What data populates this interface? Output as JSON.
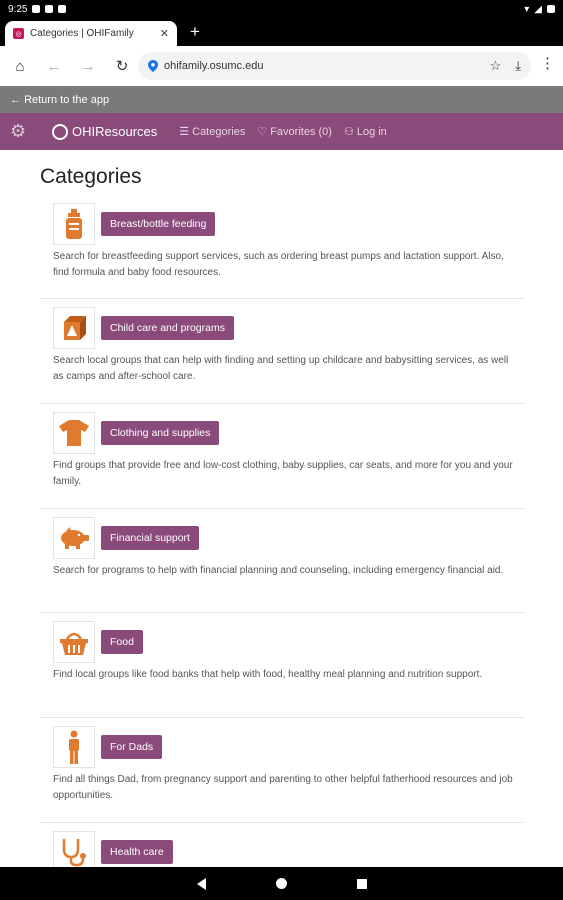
{
  "status": {
    "time": "9:25"
  },
  "browser": {
    "tab_title": "Categories | OHIFamily",
    "tab_close": "✕",
    "new_tab": "+",
    "url": "ohifamily.osumc.edu"
  },
  "returnbar": {
    "label": "Return to the app"
  },
  "nav": {
    "brand": "OHIResources",
    "links": [
      {
        "label": "Categories",
        "icon": "list-icon"
      },
      {
        "label": "Favorites (0)",
        "icon": "heart-icon"
      },
      {
        "label": "Log in",
        "icon": "user-icon"
      }
    ]
  },
  "page": {
    "title": "Categories",
    "categories": [
      {
        "label": "Breast/bottle feeding",
        "icon": "bottle-icon",
        "description": "Search for breastfeeding support services, such as ordering breast pumps and lactation support. Also, find formula and baby food resources."
      },
      {
        "label": "Child care and programs",
        "icon": "toy-block-icon",
        "description": "Search local groups that can help with finding and setting up childcare and babysitting services, as well as camps and after-school care."
      },
      {
        "label": "Clothing and supplies",
        "icon": "shirt-icon",
        "description": "Find groups that provide free and low-cost clothing, baby supplies, car seats, and more for you and your family."
      },
      {
        "label": "Financial support",
        "icon": "piggy-bank-icon",
        "description": "Search for programs to help with financial planning and counseling, including emergency financial aid."
      },
      {
        "label": "Food",
        "icon": "basket-icon",
        "description": "Find local groups like food banks that help with food, healthy meal planning and nutrition support."
      },
      {
        "label": "For Dads",
        "icon": "man-icon",
        "description": "Find all things Dad, from pregnancy support and parenting to other helpful fatherhood resources and job opportunities."
      },
      {
        "label": "Health care",
        "icon": "stethoscope-icon",
        "description": ""
      }
    ]
  },
  "colors": {
    "accent": "#8a4a7a",
    "icon_orange": "#e07a2e"
  }
}
